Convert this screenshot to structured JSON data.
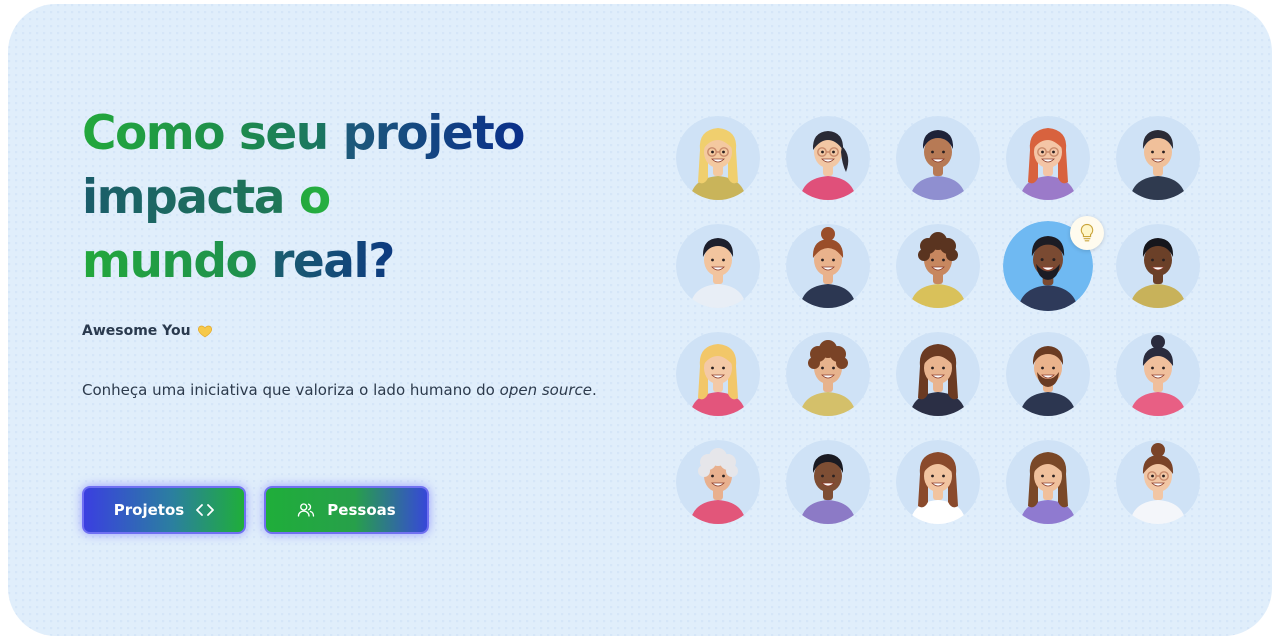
{
  "headline": {
    "line1": [
      {
        "text": "Como seu ",
        "style": "g1"
      },
      {
        "text": "projeto",
        "style": "g2"
      }
    ],
    "line2": [
      {
        "text": "impacta ",
        "style": "g3"
      },
      {
        "text": "o",
        "style": "g4"
      }
    ],
    "line3": [
      {
        "text": "mundo ",
        "style": "g5"
      },
      {
        "text": "real?",
        "style": "g6"
      }
    ]
  },
  "tagline": {
    "text": "Awesome You",
    "icon": "yellow-heart-icon"
  },
  "description": {
    "prefix": "Conheça uma iniciativa que valoriza o lado humano do ",
    "emphasis": "open source",
    "suffix": "."
  },
  "buttons": {
    "projetos": {
      "label": "Projetos",
      "icon": "code-brackets-icon"
    },
    "pessoas": {
      "label": "Pessoas",
      "icon": "users-icon"
    }
  },
  "avatars": [
    {
      "name": "avatar-blonde-woman-glasses",
      "skin": "#f4c9a0",
      "hair": "#f0cf6e",
      "shirt": "#c9b45a",
      "bg": "#cfe2f6",
      "hairStyle": "long",
      "glasses": true
    },
    {
      "name": "avatar-woman-glasses-ponytail",
      "skin": "#f2c7a4",
      "hair": "#2a2a35",
      "shirt": "#e0507a",
      "bg": "#cfe2f6",
      "hairStyle": "bun-side",
      "glasses": true
    },
    {
      "name": "avatar-man-dark-hair",
      "skin": "#b77a55",
      "hair": "#1e2238",
      "shirt": "#8f8fd0",
      "bg": "#cfe2f6",
      "hairStyle": "short",
      "glasses": false
    },
    {
      "name": "avatar-redhead-woman-glasses",
      "skin": "#f4c5a6",
      "hair": "#d8623e",
      "shirt": "#9b7ac9",
      "bg": "#cfe2f6",
      "hairStyle": "long",
      "glasses": true
    },
    {
      "name": "avatar-man-suit",
      "skin": "#f0c09a",
      "hair": "#2b2b36",
      "shirt": "#2f3a4f",
      "bg": "#cfe2f6",
      "hairStyle": "short",
      "glasses": false
    },
    {
      "name": "avatar-man-short-dark-hair",
      "skin": "#f2c49e",
      "hair": "#1d1f2c",
      "shirt": "#e8eef6",
      "bg": "#cfe2f6",
      "hairStyle": "short",
      "glasses": false
    },
    {
      "name": "avatar-woman-bun-brown",
      "skin": "#e9b28c",
      "hair": "#9a4e2a",
      "shirt": "#2c3752",
      "bg": "#cfe2f6",
      "hairStyle": "bun",
      "glasses": false
    },
    {
      "name": "avatar-curly-man",
      "skin": "#c7875f",
      "hair": "#5a3420",
      "shirt": "#d9c15a",
      "bg": "#cfe2f6",
      "hairStyle": "curly",
      "glasses": false
    },
    {
      "name": "avatar-bearded-man-highlighted",
      "skin": "#7a4a32",
      "hair": "#1c1c24",
      "shirt": "#2e3a5a",
      "bg": "#6fb9f2",
      "hairStyle": "short",
      "glasses": false,
      "beard": true
    },
    {
      "name": "avatar-dark-skinned-man",
      "skin": "#6b4028",
      "hair": "#16161c",
      "shirt": "#c8b25a",
      "bg": "#cfe2f6",
      "hairStyle": "short",
      "glasses": false
    },
    {
      "name": "avatar-blonde-woman-long",
      "skin": "#f4c9a6",
      "hair": "#f2c769",
      "shirt": "#e3557c",
      "bg": "#cfe2f6",
      "hairStyle": "long",
      "glasses": false
    },
    {
      "name": "avatar-curly-brown-man",
      "skin": "#e7b38d",
      "hair": "#7a4326",
      "shirt": "#d4c06a",
      "bg": "#cfe2f6",
      "hairStyle": "curly",
      "glasses": false
    },
    {
      "name": "avatar-brunette-woman",
      "skin": "#e9b48f",
      "hair": "#6b3a22",
      "shirt": "#2b2f45",
      "bg": "#cfe2f6",
      "hairStyle": "long",
      "glasses": false
    },
    {
      "name": "avatar-bearded-man-suit",
      "skin": "#eab38c",
      "hair": "#6a3b22",
      "shirt": "#2c3650",
      "bg": "#cfe2f6",
      "hairStyle": "short",
      "glasses": false,
      "beard": true
    },
    {
      "name": "avatar-woman-top-bun",
      "skin": "#f0bf9c",
      "hair": "#2a2b3d",
      "shirt": "#e85f84",
      "bg": "#cfe2f6",
      "hairStyle": "bun",
      "glasses": false
    },
    {
      "name": "avatar-older-woman",
      "skin": "#e8b08e",
      "hair": "#e6e6ea",
      "shirt": "#e2567a",
      "bg": "#cfe2f6",
      "hairStyle": "curly",
      "glasses": false
    },
    {
      "name": "avatar-man-hoodie",
      "skin": "#7e4e34",
      "hair": "#1a1a22",
      "shirt": "#8c7ac6",
      "bg": "#cfe2f6",
      "hairStyle": "short",
      "glasses": false
    },
    {
      "name": "avatar-laughing-woman",
      "skin": "#f2c4a0",
      "hair": "#8a4a2c",
      "shirt": "#ffffff",
      "bg": "#cfe2f6",
      "hairStyle": "long",
      "glasses": false
    },
    {
      "name": "avatar-woman-phone",
      "skin": "#f0c09c",
      "hair": "#7a4828",
      "shirt": "#8f7ad0",
      "bg": "#cfe2f6",
      "hairStyle": "long",
      "glasses": false
    },
    {
      "name": "avatar-woman-red-glasses",
      "skin": "#f2c6a4",
      "hair": "#7a4328",
      "shirt": "#f4f6fa",
      "bg": "#cfe2f6",
      "hairStyle": "bun",
      "glasses": true
    }
  ]
}
